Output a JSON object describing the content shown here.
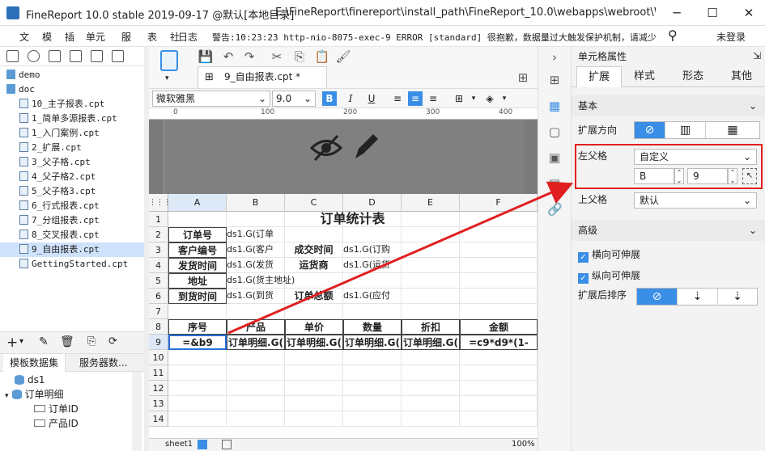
{
  "window": {
    "title": "FineReport 10.0 stable 2019-09-17 @默认[本地目录]",
    "path": "E:\\FineReport\\finereport\\install_path\\FineReport_10.0\\webapps\\webroot\\WEB-I...",
    "min": "─",
    "max": "☐",
    "close": "✕"
  },
  "menubar": {
    "items": [
      "文",
      "模",
      "插",
      "单元",
      "服",
      "表",
      "社",
      "日志"
    ],
    "log": "警告:10:23:23 http-nio-8075-exec-9 ERROR [standard] 很抱歉，数据量过大触发保护机制，请减少...",
    "login": "未登录"
  },
  "tree": [
    {
      "label": "demo",
      "type": "folder"
    },
    {
      "label": "doc",
      "type": "folder"
    },
    {
      "label": "10_主子报表.cpt",
      "type": "file"
    },
    {
      "label": "1_简单多源报表.cpt",
      "type": "file"
    },
    {
      "label": "1_入门案例.cpt",
      "type": "file"
    },
    {
      "label": "2_扩展.cpt",
      "type": "file"
    },
    {
      "label": "3_父子格.cpt",
      "type": "file"
    },
    {
      "label": "4_父子格2.cpt",
      "type": "file"
    },
    {
      "label": "5_父子格3.cpt",
      "type": "file"
    },
    {
      "label": "6_行式报表.cpt",
      "type": "file"
    },
    {
      "label": "7_分组报表.cpt",
      "type": "file"
    },
    {
      "label": "8_交叉报表.cpt",
      "type": "file"
    },
    {
      "label": "9_自由报表.cpt",
      "type": "file",
      "selected": true
    },
    {
      "label": "GettingStarted.cpt",
      "type": "file"
    }
  ],
  "dataset_tabs": [
    "模板数据集",
    "服务器数..."
  ],
  "datasets": [
    {
      "label": "ds1",
      "kind": "db"
    },
    {
      "label": "订单明细",
      "kind": "db"
    },
    {
      "label": "订单ID",
      "kind": "field"
    },
    {
      "label": "产品ID",
      "kind": "field"
    }
  ],
  "editor": {
    "tab": "9_自由报表.cpt *",
    "font": "微软雅黑",
    "size": "9.0",
    "bold": "B",
    "italic": "I",
    "underline": "U"
  },
  "ruler": [
    "0",
    "100",
    "200",
    "300",
    "400"
  ],
  "columns": [
    "A",
    "B",
    "C",
    "D",
    "E",
    "F"
  ],
  "rows": [
    "1",
    "2",
    "3",
    "4",
    "5",
    "6",
    "7",
    "8",
    "9",
    "10",
    "11",
    "12",
    "13",
    "14"
  ],
  "cells": {
    "title": "订单统计表",
    "r2": [
      "订单号",
      "ds1.G(订单"
    ],
    "r3": [
      "客户编号",
      "ds1.G(客户",
      "成交时间",
      "ds1.G(订购"
    ],
    "r4": [
      "发货时间",
      "ds1.G(发货",
      "运货商",
      "ds1.G(运货"
    ],
    "r5": [
      "地址",
      "ds1.G(货主地址)"
    ],
    "r6": [
      "到货时间",
      "ds1.G(到货",
      "订单总额",
      "ds1.G(应付"
    ],
    "r8": [
      "序号",
      "产品",
      "单价",
      "数量",
      "折扣",
      "金额"
    ],
    "r9": [
      "=&b9",
      "订单明细.G(",
      "订单明细.G(",
      "订单明细.G(",
      "订单明细.G(",
      "=c9*d9*(1-"
    ]
  },
  "sheet": {
    "name": "sheet1",
    "zoom": "100%"
  },
  "props": {
    "header": "单元格属性",
    "tabs": [
      "扩展",
      "样式",
      "形态",
      "其他"
    ],
    "basic": "基本",
    "expand_dir": "扩展方向",
    "left_parent": "左父格",
    "left_parent_value": "自定义",
    "left_col": "B",
    "left_row": "9",
    "up_parent": "上父格",
    "up_parent_value": "默认",
    "advanced": "高级",
    "horiz_expand": "横向可伸展",
    "vert_expand": "纵向可伸展",
    "sort_after": "扩展后排序"
  },
  "colors": {
    "accent": "#3a8ee6",
    "annotation": "#e02020"
  }
}
